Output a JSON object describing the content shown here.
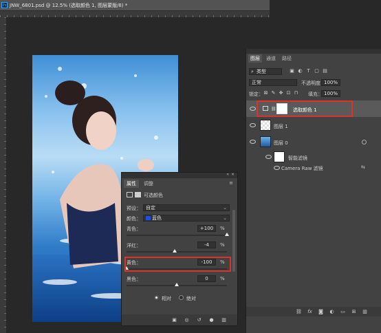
{
  "document": {
    "tab_title": "JNW_6801.psd @ 12.5% (选取颜色 1, 图层蒙版/8) *"
  },
  "properties_panel": {
    "tabs": [
      "属性",
      "调整"
    ],
    "header": "可选颜色",
    "preset_label": "预设：",
    "preset_value": "自定",
    "color_label": "颜色：",
    "color_value": "蓝色",
    "color_swatch": "#1b4fe8",
    "sliders": [
      {
        "label": "青色：",
        "value": "+100",
        "unit": "%",
        "level": 1.0
      },
      {
        "label": "洋红：",
        "value": "-4",
        "unit": "%",
        "level": 0.48
      },
      {
        "label": "黄色：",
        "value": "-100",
        "unit": "%",
        "level": 0.0
      },
      {
        "label": "黑色：",
        "value": "0",
        "unit": "%",
        "level": 0.5
      }
    ],
    "mode_options": [
      "相对",
      "绝对"
    ],
    "mode_selected": "相对"
  },
  "layers_panel": {
    "tabs": [
      "图层",
      "通道",
      "路径"
    ],
    "filter_label": "类型",
    "blend_mode": "正常",
    "opacity_label": "不透明度：",
    "opacity_value": "100%",
    "lock_label": "锁定：",
    "fill_label": "填充：",
    "fill_value": "100%",
    "layers": [
      {
        "name": "选取颜色 1"
      },
      {
        "name": "图层 1"
      },
      {
        "name": "图层 0"
      },
      {
        "name": "智能滤镜"
      },
      {
        "name": "Camera Raw 滤镜"
      }
    ],
    "footer_icons": [
      "link-icon",
      "fx-icon",
      "mask-icon",
      "adjustment-icon",
      "group-icon",
      "new-layer-icon",
      "trash-icon"
    ]
  },
  "colors": {
    "accent": "#e0302a",
    "panel": "#424242",
    "workspace": "#282828"
  }
}
